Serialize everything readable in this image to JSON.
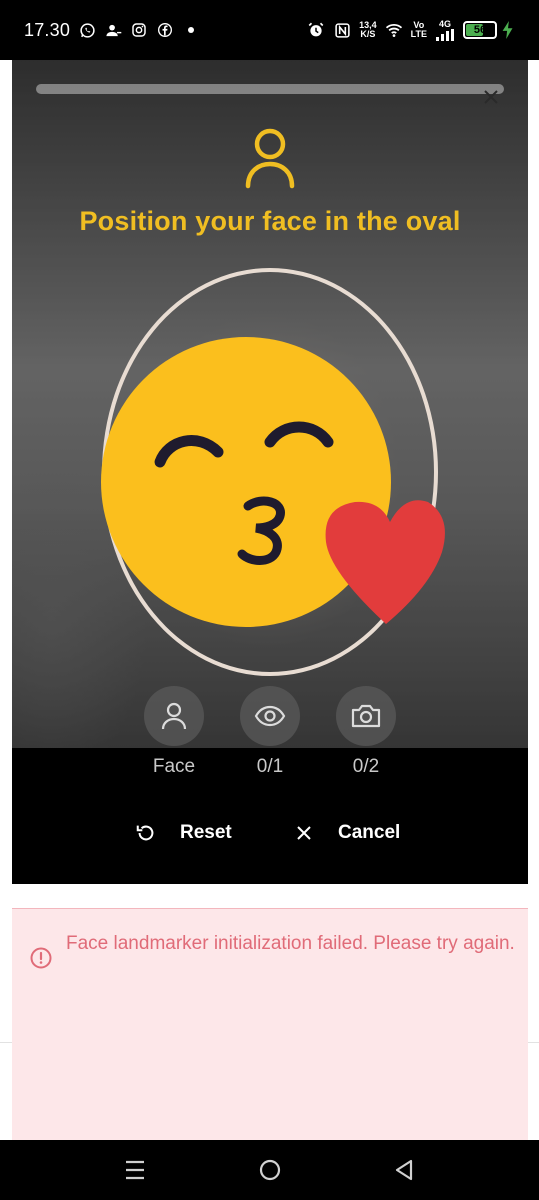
{
  "status_bar": {
    "time": "17.30",
    "net_speed_value": "13,4",
    "net_speed_unit": "K/S",
    "volte_top": "Vo",
    "volte_bottom": "LTE",
    "network_type": "4G",
    "battery_level": "56",
    "battery_fraction": 0.56,
    "battery_color": "#4caf50",
    "left_icons": [
      "whatsapp-icon",
      "contacts-icon",
      "instagram-icon",
      "facebook-icon",
      "notification-dot"
    ],
    "right_icons": [
      "alarm-icon",
      "nfc-icon",
      "wifi-icon",
      "signal-icon",
      "charging-icon"
    ]
  },
  "camera": {
    "progress_fraction": 0.0,
    "instruction": "Position your face in the oval",
    "accent_color": "#f0be22",
    "guide_icon": "person-icon",
    "overlay": "kissing-face-emoji-with-heart"
  },
  "steps": [
    {
      "icon": "person-icon",
      "label": "Face"
    },
    {
      "icon": "eye-icon",
      "label": "0/1"
    },
    {
      "icon": "camera-icon",
      "label": "0/2"
    }
  ],
  "actions": {
    "reset_label": "Reset",
    "cancel_label": "Cancel"
  },
  "error": {
    "message": "Face landmarker initialization failed. Please try again.",
    "text_color": "#e06b78",
    "background_color": "#fde7e9"
  },
  "nav_bar": {
    "buttons": [
      "recent-apps-icon",
      "home-icon",
      "back-icon"
    ]
  }
}
